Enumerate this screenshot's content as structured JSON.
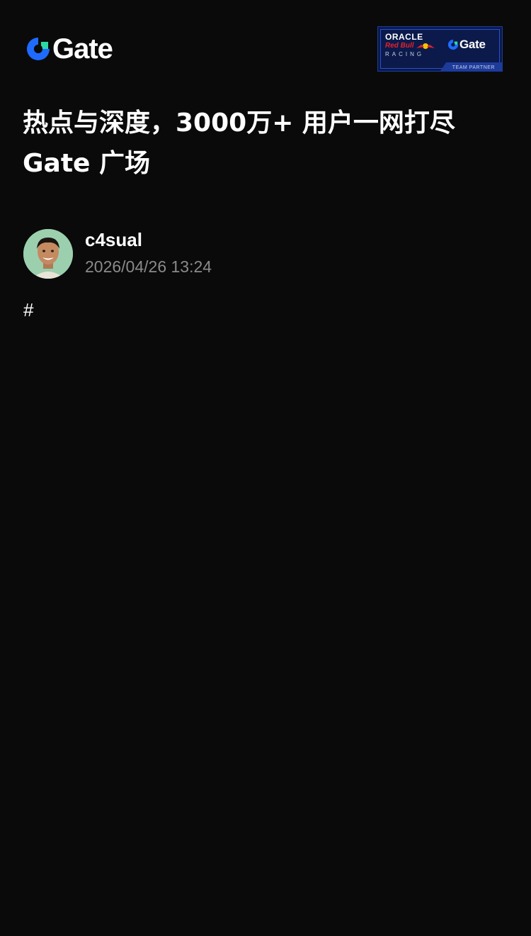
{
  "header": {
    "logo": {
      "icon": "gate-logo-icon",
      "wordmark": "Gate"
    },
    "partner_badge": {
      "oracle": "ORACLE",
      "redbull": "Red Bull",
      "bull_icon": "red-bull-icon",
      "racing": "RACING",
      "gate_icon": "gate-logo-icon",
      "gate": "Gate",
      "partner": "TEAM PARTNER"
    }
  },
  "title": {
    "line1": "热点与深度，3000万+ 用户一网打尽",
    "line2": "Gate 广场"
  },
  "author": {
    "avatar_icon": "user-avatar",
    "name": "c4sual",
    "time": "2026/04/26 13:24"
  },
  "post": {
    "body": "#"
  },
  "colors": {
    "background": "#0a0a0a",
    "logo_blue": "#1f6bff",
    "logo_green": "#2bd9a5",
    "meta_gray": "#8a8a8a",
    "badge_navy": "#0b1a4a"
  }
}
